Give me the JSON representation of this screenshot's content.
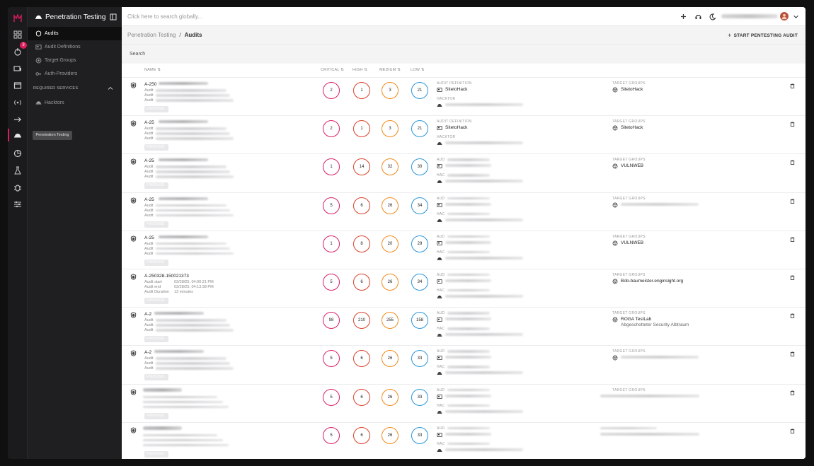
{
  "app": {
    "title": "Penetration Testing",
    "search_placeholder": "Click here to search globally...",
    "brand_color": "#d81e5b",
    "notification_count": "3",
    "tooltip": "Penetration Testing"
  },
  "nav": {
    "items": [
      {
        "label": "Audits",
        "icon": "shield-icon"
      },
      {
        "label": "Audit Definitions",
        "icon": "definition-icon"
      },
      {
        "label": "Target Groups",
        "icon": "target-icon"
      },
      {
        "label": "Auth-Providers",
        "icon": "key-icon"
      }
    ],
    "section_label": "REQUIRED SERVICES",
    "section_items": [
      {
        "label": "Hacktors",
        "icon": "hacker-icon"
      }
    ]
  },
  "breadcrumb": {
    "parent": "Penetration Testing",
    "sep": "/",
    "current": "Audits"
  },
  "actions": {
    "start_audit": "START PENTESTING AUDIT"
  },
  "search_label": "Search",
  "table": {
    "columns": {
      "name": "NAME",
      "critical": "CRITICAL",
      "high": "HIGH",
      "medium": "MEDIUM",
      "low": "LOW"
    },
    "meta_labels": {
      "audit_definition": "AUDIT DEFINITION",
      "hacktor": "HACKTOR",
      "target_groups": "TARGET GROUPS",
      "aud_short": "AUD",
      "hac_short": "HAC"
    },
    "status_label": "FINISHED",
    "rows": [
      {
        "id": "A-250",
        "critical": "2",
        "high": "1",
        "medium": "3",
        "low": "21",
        "definition": "SitetoHack",
        "target": "SitetoHack",
        "target2": "",
        "def_visible": true
      },
      {
        "id": "A-25",
        "critical": "2",
        "high": "1",
        "medium": "3",
        "low": "21",
        "definition": "SitetoHack",
        "target": "SitetoHack",
        "target2": "",
        "def_visible": true
      },
      {
        "id": "A-25",
        "critical": "1",
        "high": "14",
        "medium": "32",
        "low": "30",
        "definition": "",
        "target": "VULNWEB",
        "target2": "",
        "def_visible": false
      },
      {
        "id": "A-25",
        "critical": "5",
        "high": "6",
        "medium": "26",
        "low": "34",
        "definition": "",
        "target": "",
        "target2": "",
        "def_visible": false
      },
      {
        "id": "A-25",
        "critical": "1",
        "high": "8",
        "medium": "20",
        "low": "29",
        "definition": "",
        "target": "VULNWEB",
        "target2": "",
        "def_visible": false
      },
      {
        "id": "A-250328-150021373",
        "critical": "5",
        "high": "6",
        "medium": "26",
        "low": "34",
        "definition": "",
        "target": "Bob-baumeister.enginsight.org",
        "target2": "",
        "def_visible": false,
        "details": {
          "start_label": "Audit start",
          "start": "03/28/25, 04:00:21 PM",
          "end_label": "Audit end",
          "end": "03/28/25, 04:13:38 PM",
          "dur_label": "Audit Duration",
          "dur": "13 minutes"
        }
      },
      {
        "id": "A-2",
        "critical": "98",
        "high": "210",
        "medium": "255",
        "low": "158",
        "definition": "",
        "target": "ROGA TestLab",
        "target2": "Abgeschotteter Security Albtraum",
        "def_visible": false
      },
      {
        "id": "A-2",
        "critical": "5",
        "high": "6",
        "medium": "26",
        "low": "33",
        "definition": "",
        "target": "",
        "target2": "",
        "def_visible": false
      },
      {
        "id": "",
        "critical": "5",
        "high": "6",
        "medium": "26",
        "low": "33",
        "definition": "",
        "target": "",
        "target2": "",
        "def_visible": false
      },
      {
        "id": "",
        "critical": "5",
        "high": "6",
        "medium": "26",
        "low": "33",
        "definition": "",
        "target": "",
        "target2": "",
        "def_visible": false
      }
    ],
    "audit_line_label": "Audit"
  }
}
